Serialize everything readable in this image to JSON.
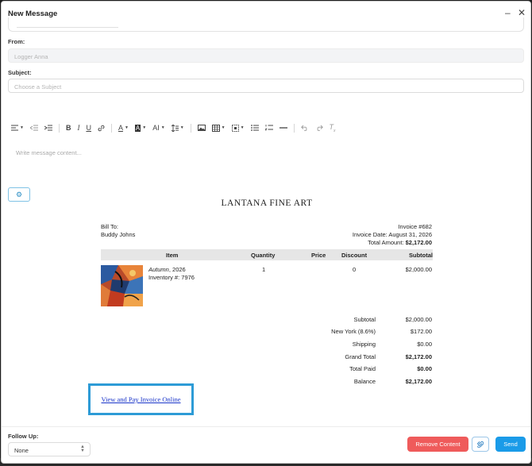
{
  "window": {
    "title": "New Message",
    "minimize_icon": "minimize-icon",
    "close_icon": "close-icon"
  },
  "form": {
    "from_label": "From:",
    "from_value": "Logger Anna",
    "subject_label": "Subject:",
    "subject_placeholder": "Choose a Subject"
  },
  "toolbar": {
    "items": [
      "align-left-icon",
      "indent-decrease-icon",
      "indent-increase-icon",
      "bold-icon",
      "italic-icon",
      "underline-icon",
      "link-icon",
      "text-color-icon",
      "highlight-color-icon",
      "font-size-icon",
      "line-height-icon",
      "image-icon",
      "table-icon",
      "embed-icon",
      "bullet-list-icon",
      "numbered-list-icon",
      "horizontal-rule-icon",
      "undo-icon",
      "redo-icon",
      "clear-format-icon"
    ]
  },
  "editor": {
    "placeholder": "Write message content..."
  },
  "invoice": {
    "store_name": "LANTANA FINE ART",
    "bill_to_label": "Bill To:",
    "bill_to_name": "Buddy Johns",
    "invoice_number": "Invoice #682",
    "invoice_date": "Invoice Date: August 31, 2026",
    "total_amount_label": "Total Amount:",
    "total_amount_value": "$2,172.00",
    "columns": {
      "item": "Item",
      "quantity": "Quantity",
      "price": "Price",
      "discount": "Discount",
      "subtotal": "Subtotal"
    },
    "line_item": {
      "title": "Autumn",
      "year": ", 2026",
      "inventory": "Inventory #: 7976",
      "quantity": "1",
      "price": "",
      "discount": "0",
      "subtotal": "$2,000.00"
    },
    "totals": [
      {
        "label": "Subtotal",
        "value": "$2,000.00",
        "bold": false
      },
      {
        "label": "New York (8.6%)",
        "value": "$172.00",
        "bold": false
      },
      {
        "label": "Shipping",
        "value": "$0.00",
        "bold": false
      },
      {
        "label": "Grand Total",
        "value": "$2,172.00",
        "bold": true
      },
      {
        "label": "Total Paid",
        "value": "$0.00",
        "bold": true
      },
      {
        "label": "Balance",
        "value": "$2,172.00",
        "bold": true
      }
    ],
    "pay_link": "View and Pay Invoice Online"
  },
  "footer": {
    "follow_up_label": "Follow Up:",
    "follow_up_value": "None",
    "remove_content": "Remove Content",
    "send": "Send"
  },
  "colors": {
    "remove": "#ef5b5b",
    "send": "#1a9be8",
    "highlight_box": "#2d9bd6",
    "link": "#1a35c9"
  }
}
